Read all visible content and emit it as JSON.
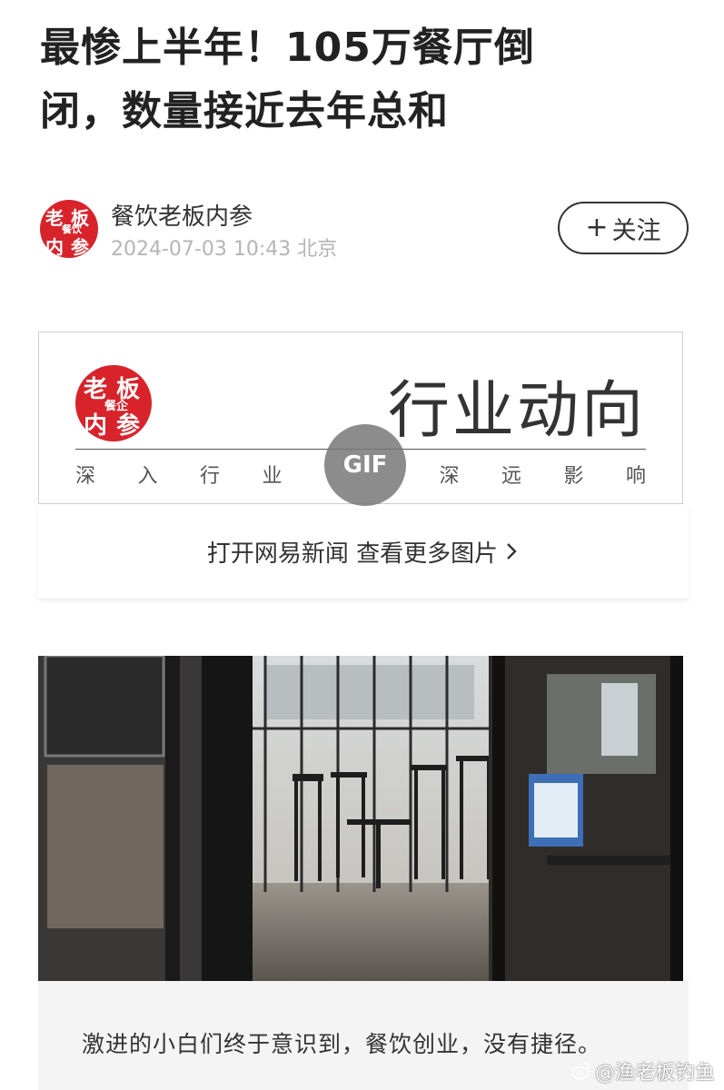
{
  "article": {
    "title_line1": "最惨上半年！105万餐厅倒",
    "title_line2": "闭，数量接近去年总和"
  },
  "author": {
    "name": "餐饮老板内参",
    "datetime": "2024-07-03 10:43 北京",
    "follow_label": "关注",
    "follow_icon": "plus-icon"
  },
  "banner": {
    "logo_text": "餐饮老板内参",
    "headline": "行业动向",
    "slogan": [
      "深",
      "入",
      "行",
      "业",
      "深",
      "远",
      "影",
      "响"
    ],
    "gif_badge": "GIF"
  },
  "gallery": {
    "open_label": "打开网易新闻 查看更多图片",
    "chevron_icon": "chevron-right-icon"
  },
  "content": {
    "paragraph1": "激进的小白们终于意识到，餐饮创业，没有捷径。"
  },
  "watermark": {
    "text": "@渔老板钓鱼",
    "icon": "weibo-icon"
  },
  "colors": {
    "brand_red": "#d8232a",
    "text_dark": "#222222",
    "date_gray": "#b5b5b5"
  }
}
